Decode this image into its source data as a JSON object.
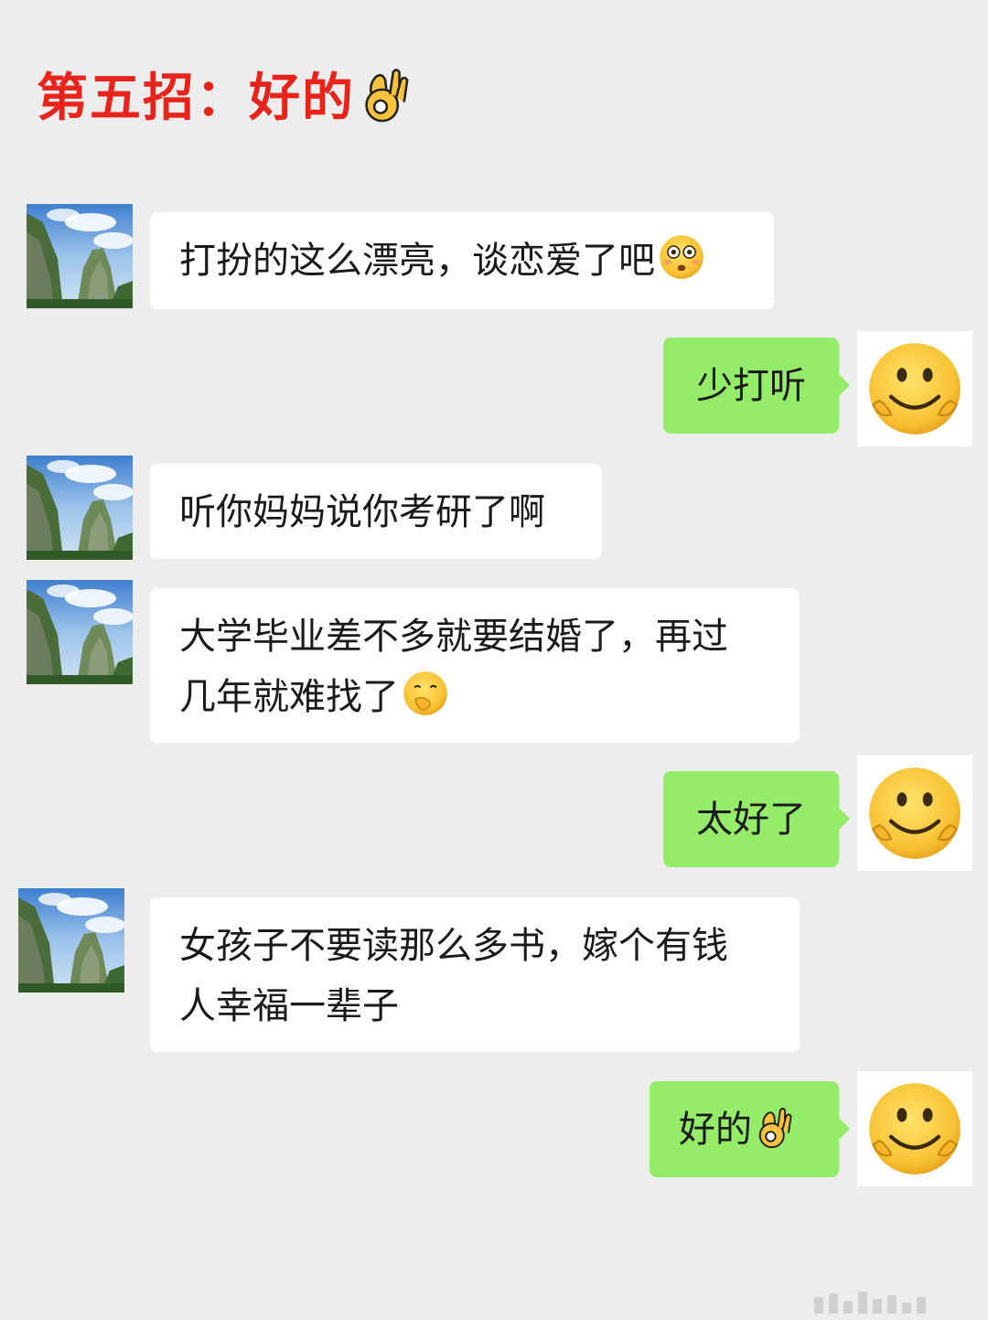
{
  "header": {
    "title": "第五招：好的",
    "title_emoji": "ok-hand-icon"
  },
  "colors": {
    "title": "#e8231a",
    "background": "#ededed",
    "self_bubble": "#95ec69",
    "other_bubble": "#ffffff"
  },
  "messages": [
    {
      "sender": "other",
      "text": "打扮的这么漂亮，谈恋爱了吧",
      "emoji": "flushed-face-icon"
    },
    {
      "sender": "self",
      "text": "少打听",
      "emoji": ""
    },
    {
      "sender": "other",
      "text": "听你妈妈说你考研了啊",
      "emoji": ""
    },
    {
      "sender": "other",
      "text_line1": "大学毕业差不多就要结婚了，再过",
      "text_line2": "几年就难找了",
      "emoji": "face-with-hand-over-mouth-icon"
    },
    {
      "sender": "self",
      "text": "太好了",
      "emoji": ""
    },
    {
      "sender": "other",
      "text_line1": "女孩子不要读那么多书，嫁个有钱",
      "text_line2": "人幸福一辈子",
      "emoji": ""
    },
    {
      "sender": "self",
      "text": "好的",
      "emoji": "ok-hand-icon"
    }
  ]
}
